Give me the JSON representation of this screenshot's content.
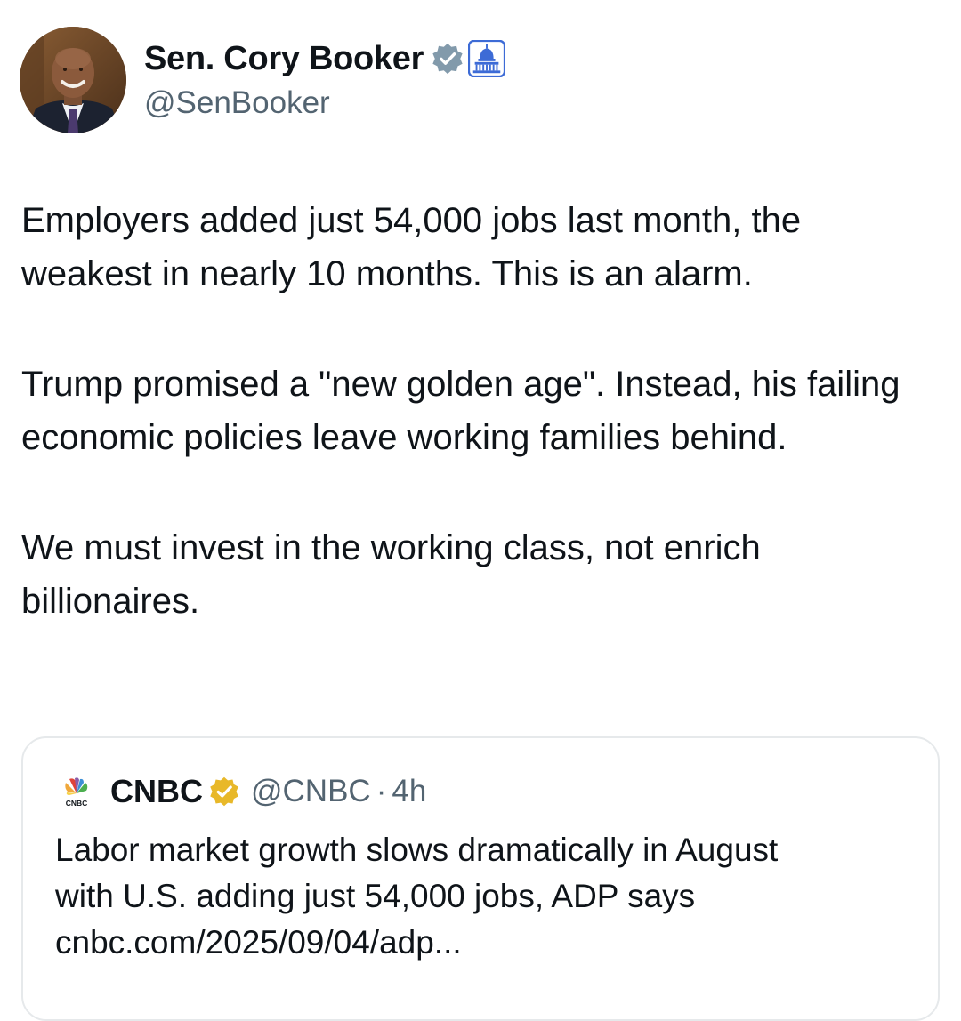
{
  "author": {
    "display_name": "Sen. Cory Booker",
    "handle": "@SenBooker",
    "avatar_icon": "profile-photo",
    "verified_icon": "verified-badge-icon",
    "affiliation_icon": "us-capitol-icon"
  },
  "tweet": {
    "paragraphs": [
      "Employers added just 54,000 jobs last month, the weakest in nearly 10 months. This is an alarm.",
      "Trump promised a \"new golden age\". Instead, his failing economic policies leave working families behind.",
      "We must invest in the working class, not enrich billionaires."
    ]
  },
  "quote": {
    "logo_text": "CNBC",
    "display_name": "CNBC",
    "handle": "@CNBC",
    "separator": "·",
    "time": "4h",
    "text_lines": [
      "Labor market growth slows dramatically in August",
      "with U.S. adding just 54,000 jobs, ADP says",
      "cnbc.com/2025/09/04/adp..."
    ]
  },
  "colors": {
    "text_primary": "#0f1419",
    "text_secondary": "#536471",
    "verified_gray": "#829aab",
    "verified_gold": "#e8b829",
    "capitol_blue": "#3d6bd6",
    "card_border": "#e6e9eb"
  }
}
